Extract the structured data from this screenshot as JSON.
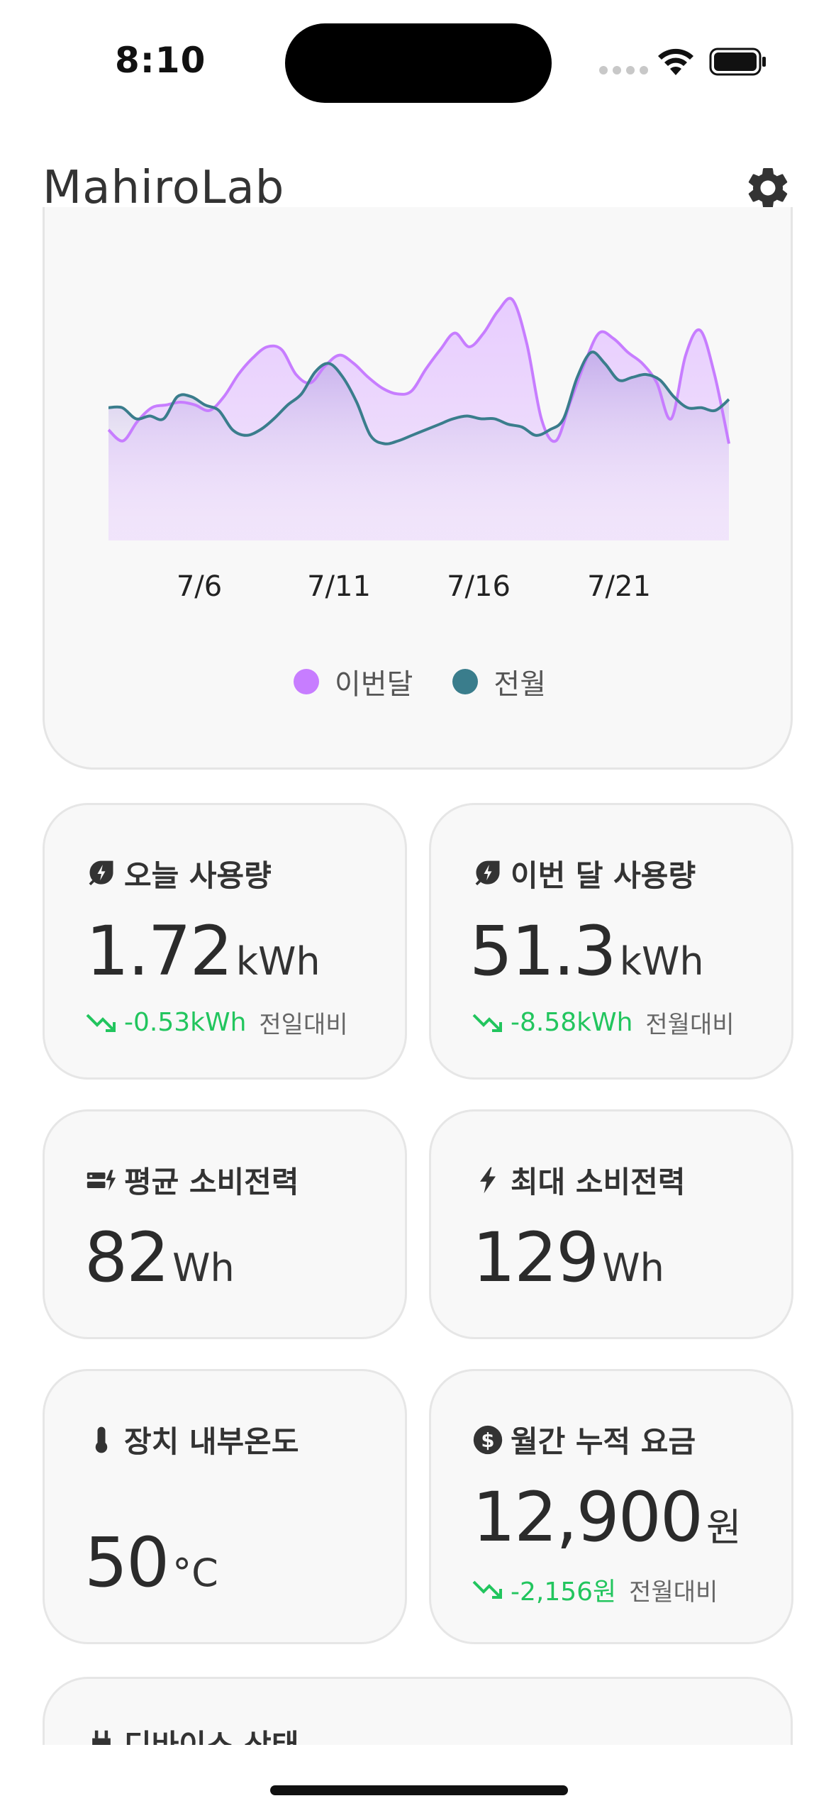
{
  "status_bar": {
    "time": "8:10"
  },
  "header": {
    "title": "MahiroLab"
  },
  "colors": {
    "this_month": "#c77dff",
    "last_month": "#3a7d8c",
    "delta_green": "#22c55e"
  },
  "chart_data": {
    "type": "area",
    "x_tick_labels": [
      "7/6",
      "7/11",
      "7/16",
      "7/21"
    ],
    "series": [
      {
        "name": "이번달",
        "values": [
          40,
          36,
          43,
          48,
          49,
          50,
          49,
          47,
          52,
          60,
          66,
          70,
          69,
          60,
          57,
          63,
          67,
          64,
          59,
          55,
          53,
          54,
          62,
          69,
          75,
          70,
          75,
          83,
          87,
          71,
          44,
          36,
          50,
          64,
          75,
          73,
          68,
          64,
          57,
          44,
          67,
          76,
          60,
          35
        ]
      },
      {
        "name": "전월",
        "values": [
          48,
          48,
          44,
          45,
          44,
          52,
          52,
          49,
          47,
          40,
          38,
          40,
          44,
          49,
          53,
          61,
          64,
          59,
          50,
          38,
          35,
          36,
          38,
          40,
          42,
          44,
          45,
          44,
          44,
          42,
          41,
          38,
          40,
          44,
          59,
          68,
          64,
          58,
          59,
          60,
          58,
          52,
          48,
          48,
          47,
          51
        ]
      }
    ],
    "ylim": [
      0,
      100
    ],
    "grid": false,
    "legend": "bottom-center"
  },
  "cards": [
    {
      "title": "오늘 사용량",
      "icon": "leaf-bolt-icon",
      "value": "1.72",
      "unit": "kWh",
      "delta": "-0.53kWh",
      "delta_label": "전일대비"
    },
    {
      "title": "이번 달 사용량",
      "icon": "leaf-bolt-icon",
      "value": "51.3",
      "unit": "kWh",
      "delta": "-8.58kWh",
      "delta_label": "전월대비"
    },
    {
      "title": "평균 소비전력",
      "icon": "battery-bolt-icon",
      "value": "82",
      "unit": "Wh"
    },
    {
      "title": "최대 소비전력",
      "icon": "bolt-icon",
      "value": "129",
      "unit": "Wh"
    },
    {
      "title": "장치 내부온도",
      "icon": "thermometer-icon",
      "value": "50",
      "unit": "°C"
    },
    {
      "title": "월간 누적 요금",
      "icon": "dollar-icon",
      "value": "12,900",
      "unit": "원",
      "delta": "-2,156원",
      "delta_label": "전월대비"
    }
  ],
  "device_status": {
    "title": "디바이스 상태",
    "icon": "plug-icon"
  }
}
